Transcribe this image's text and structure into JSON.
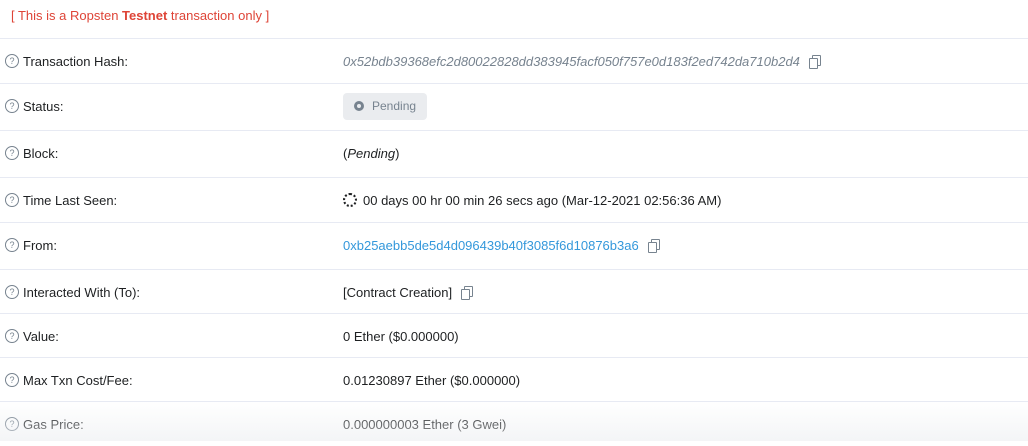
{
  "banner": {
    "prefix": "[ This is a Ropsten ",
    "emphasis": "Testnet",
    "suffix": " transaction only ]"
  },
  "rows": [
    {
      "label": "Transaction Hash:",
      "value": "0x52bdb39368efc2d80022828dd383945facf050f757e0d183f2ed742da710b2d4"
    },
    {
      "label": "Status:",
      "value": "Pending"
    },
    {
      "label": "Block:",
      "value_open": "(",
      "value_em": "Pending",
      "value_close": ")"
    },
    {
      "label": "Time Last Seen:",
      "value": "00 days 00 hr 00 min 26 secs ago (Mar-12-2021 02:56:36 AM)"
    },
    {
      "label": "From:",
      "value": "0xb25aebb5de5d4d096439b40f3085f6d10876b3a6"
    },
    {
      "label": "Interacted With (To):",
      "value": "[Contract Creation]"
    },
    {
      "label": "Value:",
      "value": "0 Ether ($0.000000)"
    },
    {
      "label": "Max Txn Cost/Fee:",
      "value": "0.01230897 Ether ($0.000000)"
    },
    {
      "label": "Gas Price:",
      "value": "0.000000003 Ether (3 Gwei)"
    }
  ],
  "icons": {
    "help": "question-circle-icon",
    "copy": "copy-icon",
    "pending": "pending-dot-icon",
    "spinner": "spinner-icon"
  },
  "colors": {
    "banner": "#de4437",
    "link": "#3498db",
    "muted": "#77838f",
    "text": "#1e2022"
  }
}
